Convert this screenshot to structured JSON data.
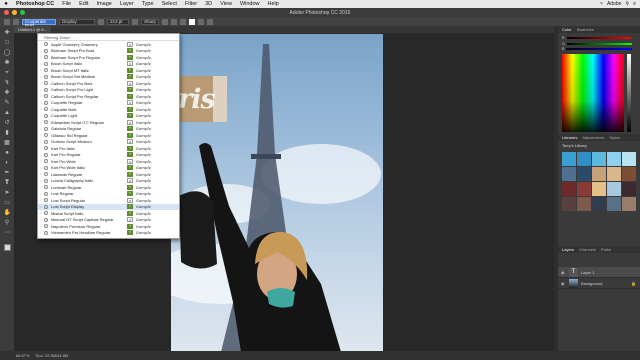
{
  "menubar": {
    "app": "Photoshop CC",
    "items": [
      "File",
      "Edit",
      "Image",
      "Layer",
      "Type",
      "Select",
      "Filter",
      "3D",
      "View",
      "Window",
      "Help"
    ],
    "right": "Adobe"
  },
  "window": {
    "title": "Adobe Photoshop CC 2015"
  },
  "options": {
    "font_family": "Cooperate Bold",
    "font_style": "Display",
    "font_size": "213 pt",
    "antialias": "Sharp"
  },
  "tab": {
    "label": "Untitled-1 @ 6..."
  },
  "fontlist": {
    "header": "Filtering Script...",
    "sample": "Sample",
    "fonts": [
      "Apple Chancery Chancery",
      "Bickham Script Pro Bold",
      "Bickham Script Pro Regular",
      "Brush Script Italic",
      "Brush Script MT Italic",
      "Brush Script Std Medium",
      "Calfoch Script Pro Bold",
      "Calfoch Script Pro Light",
      "Calfoch Script Pro Regular",
      "Coquette Regular",
      "Coquette Bold",
      "Coquette Light",
      "Edwardian Script ITC Regular",
      "Gabriola Regular",
      "Gildasio Std Regular",
      "Grafolio Script Medium",
      "Kari Pro Italic",
      "Kari Pro Regular",
      "Kari Pro Wide",
      "Kari Pro Wide Italic",
      "Lakeside Regular",
      "Lucida Calligraphy Italic",
      "Luminari Regular",
      "Lust Regular",
      "Lust Script Regular",
      "Lust Script Display",
      "Mistral Script Italic",
      "Mesural NT Script Capitals Regular",
      "Napoleon Premium Regular",
      "Vietnamien Pro Headline Regular"
    ],
    "selected_index": 25
  },
  "canvas": {
    "text": "Paris"
  },
  "panels": {
    "color_tabs": [
      "Color",
      "Swatches"
    ],
    "libraries_tabs": [
      "Libraries",
      "Adjustments",
      "Styles"
    ],
    "library_name": "Terry's Library",
    "layers_tabs": [
      "Layers",
      "Channels",
      "Paths"
    ],
    "layers": [
      {
        "name": "Layer 1",
        "type": "text"
      },
      {
        "name": "Background",
        "type": "image"
      }
    ],
    "swatch_colors": [
      "#3aa0d4",
      "#2f8fc4",
      "#5bb9e0",
      "#8fd0ee",
      "#b7e3f3",
      "#4f6f93",
      "#2a4a6a",
      "#c7a17a",
      "#d9b68c",
      "#7a4e32",
      "#6e2a2a",
      "#8c3b3b",
      "#e3c28a",
      "#a8c8e0",
      "#3d2a2f",
      "#5a3f3f",
      "#7d5a4c",
      "#2f3d4d",
      "#5a7086",
      "#9a7c6a"
    ]
  },
  "status": {
    "zoom": "66.67%",
    "doc": "Doc: 22.8M/44.8M"
  }
}
